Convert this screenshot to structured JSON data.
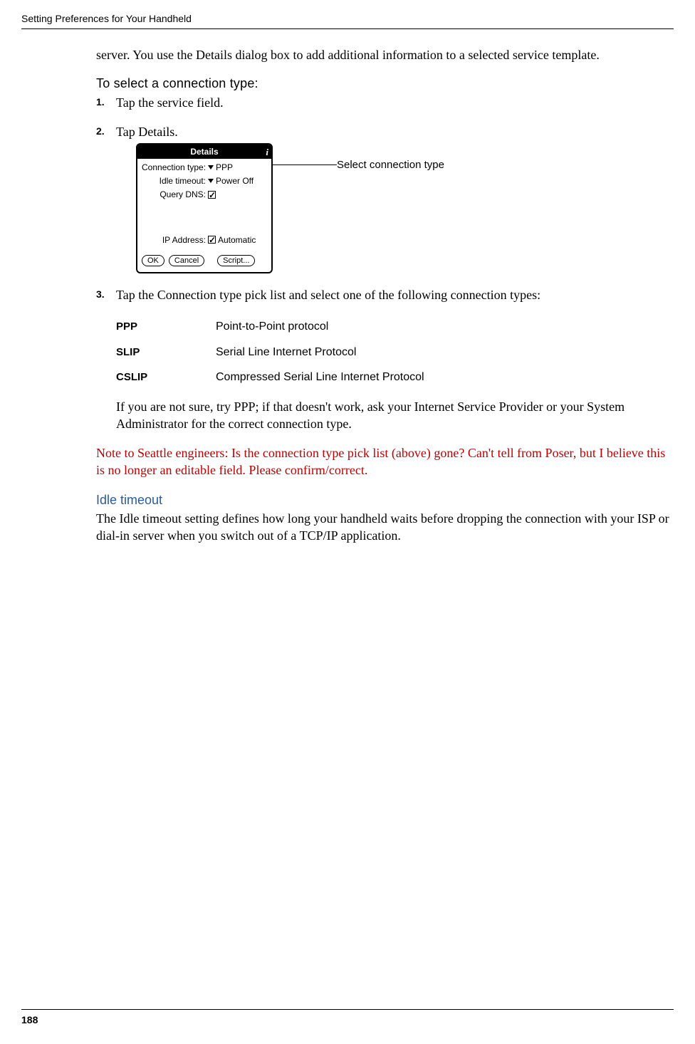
{
  "header": {
    "running_head": "Setting Preferences for Your Handheld"
  },
  "intro_paragraph": "server. You use the Details dialog box to add additional information to a selected service template.",
  "subheading1": "To select a connection type:",
  "steps": {
    "s1": "Tap the service field.",
    "s2": "Tap Details.",
    "s3": "Tap the Connection type pick list and select one of the following connection types:"
  },
  "palm": {
    "title": "Details",
    "rows": {
      "conn_label": "Connection type:",
      "conn_value": "PPP",
      "idle_label": "Idle timeout:",
      "idle_value": "Power Off",
      "dns_label": "Query DNS:",
      "ip_label": "IP Address:",
      "ip_value": "Automatic"
    },
    "buttons": {
      "ok": "OK",
      "cancel": "Cancel",
      "script": "Script..."
    }
  },
  "callout": "Select connection type",
  "defs": {
    "ppp_term": "PPP",
    "ppp_desc": "Point-to-Point protocol",
    "slip_term": "SLIP",
    "slip_desc": "Serial Line Internet Protocol",
    "cslip_term": "CSLIP",
    "cslip_desc": "Compressed Serial Line Internet Protocol"
  },
  "after_defs": "If you are not sure, try PPP; if that doesn't work, ask your Internet Service Provider or your System Administrator for the correct connection type.",
  "red_note": "Note to Seattle engineers: Is the connection type pick list (above) gone? Can't tell from Poser, but I believe this is no longer an editable field. Please confirm/correct.",
  "section2_heading": "Idle timeout",
  "section2_body": "The Idle timeout setting defines how long your handheld waits before dropping the connection with your ISP or dial-in server when you switch out of a TCP/IP application.",
  "footer": {
    "page": "188"
  }
}
